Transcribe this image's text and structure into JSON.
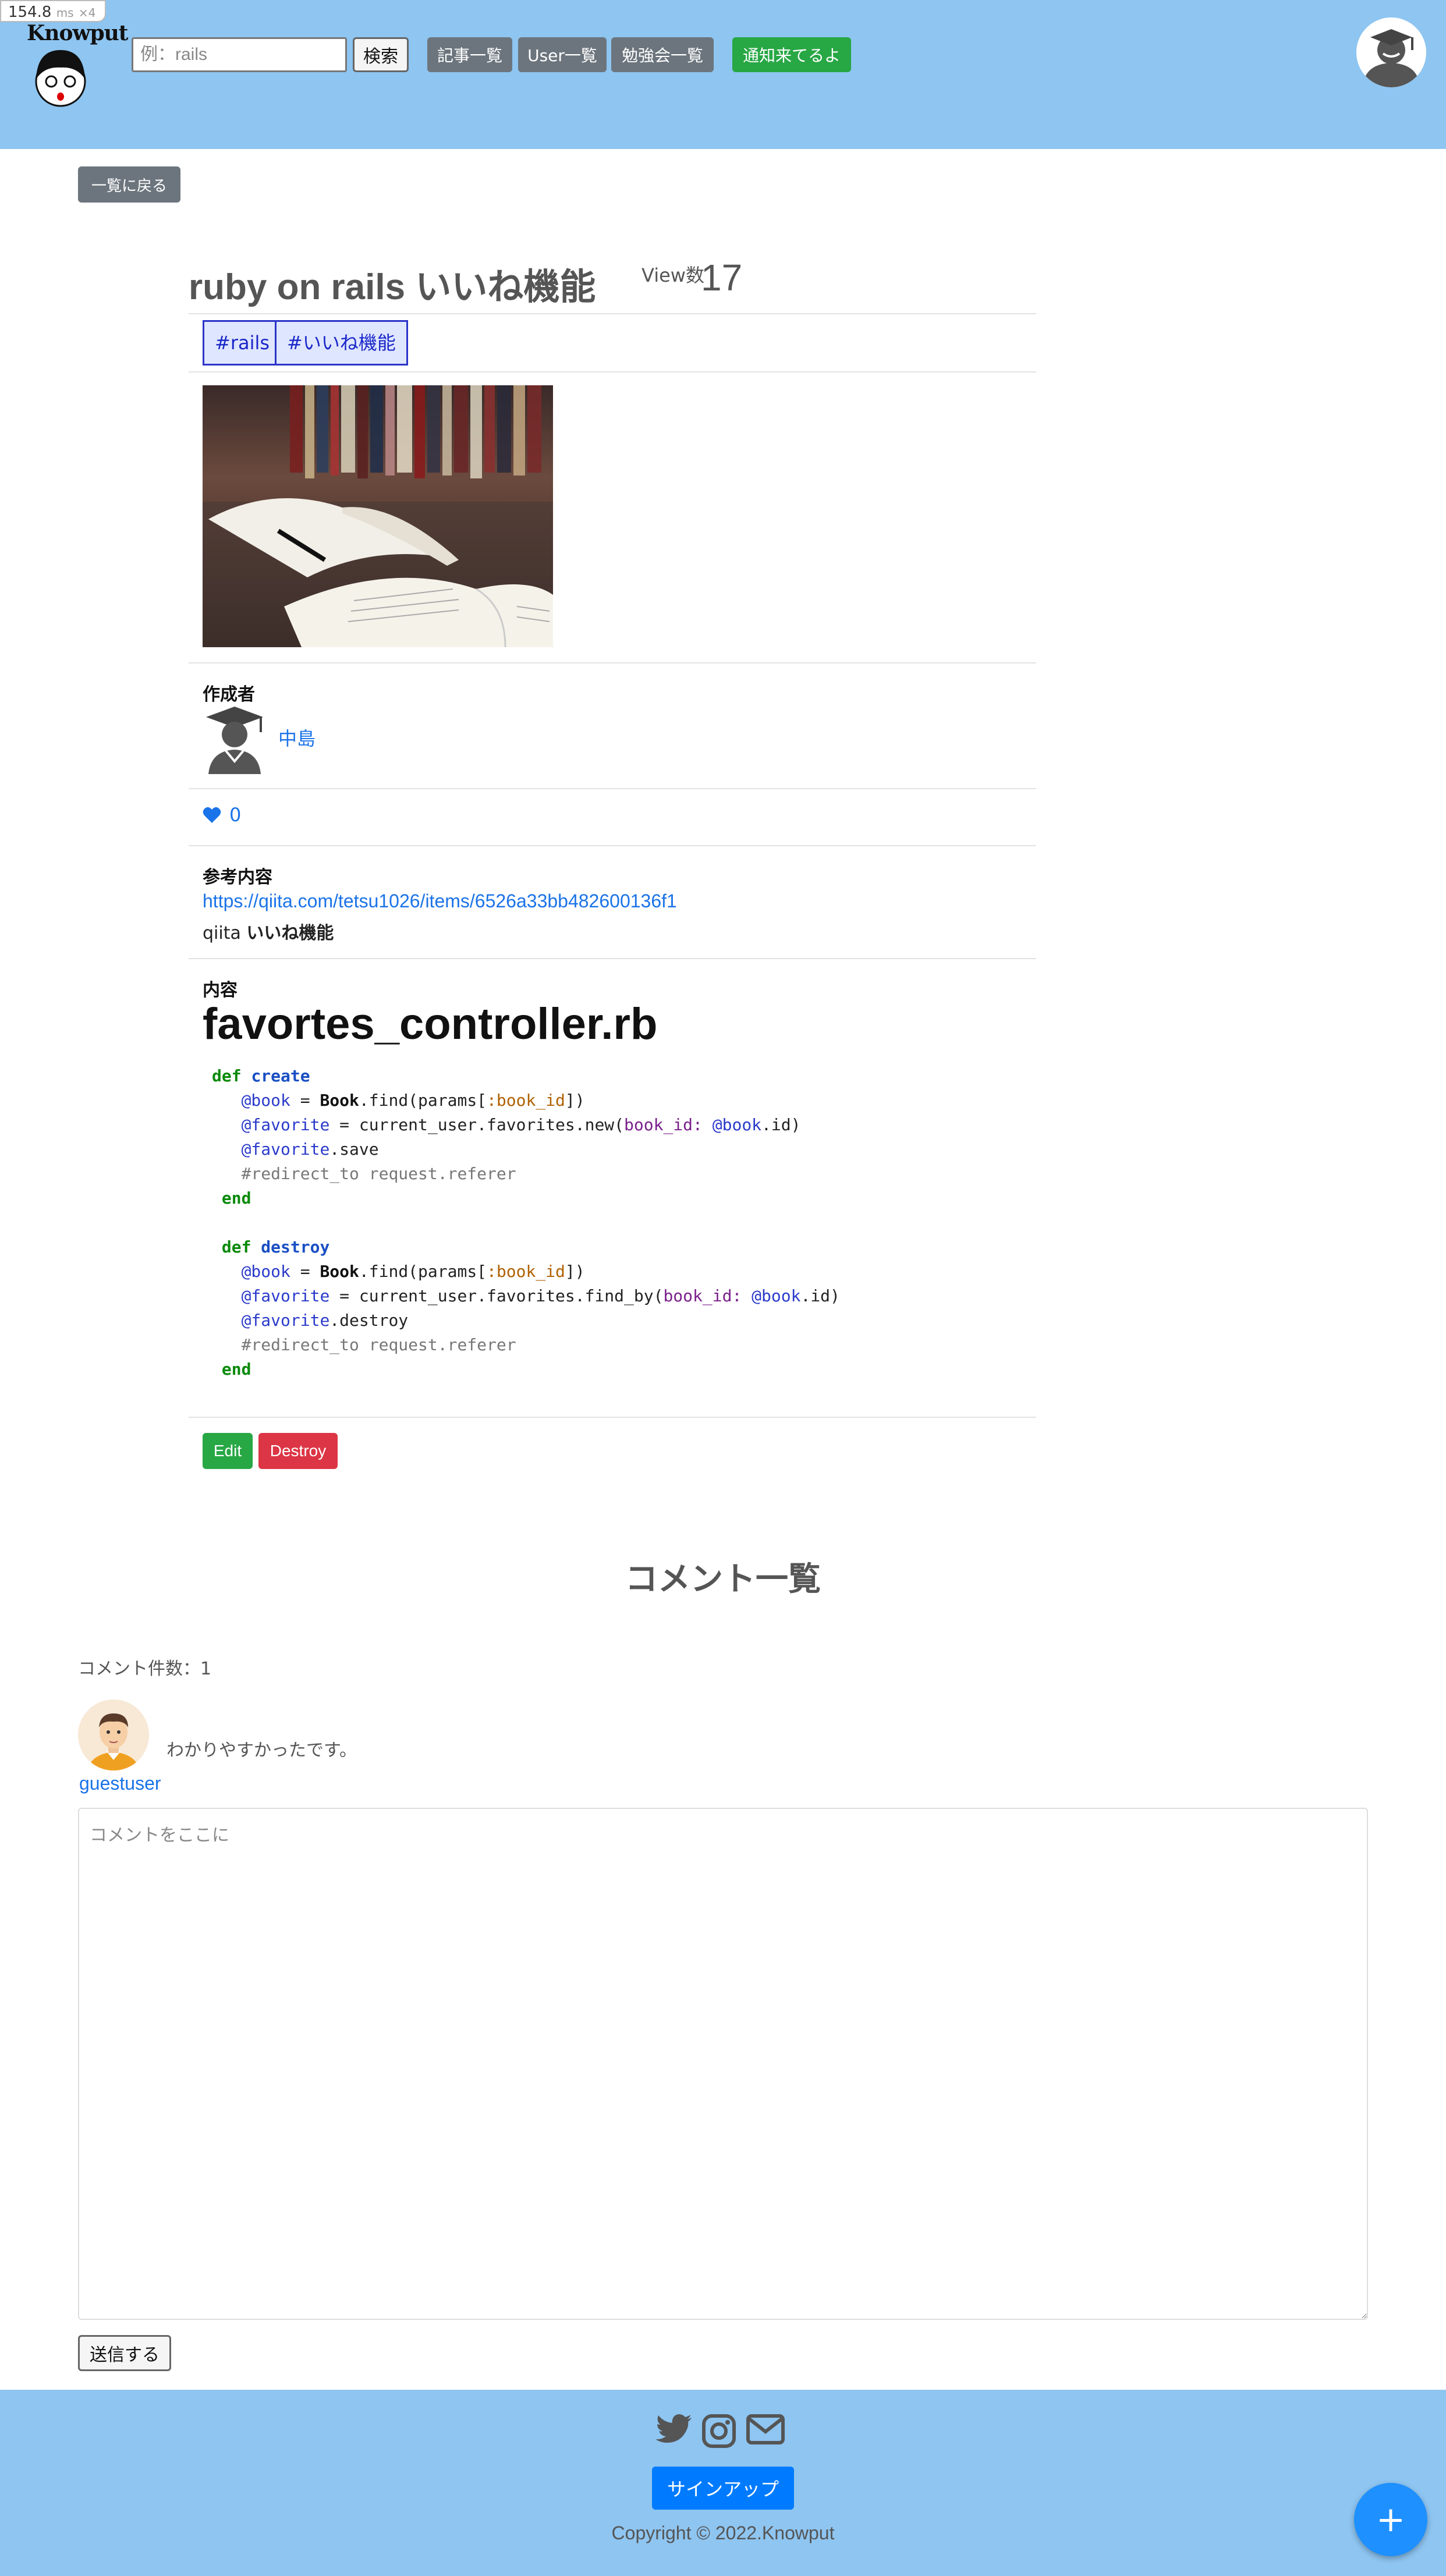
{
  "perf": {
    "value": "154.8",
    "unit": "ms",
    "multiplier": "×4"
  },
  "header": {
    "logo_text": "Knowput",
    "search": {
      "placeholder": "例：rails",
      "value": ""
    },
    "search_button": "検索",
    "nav": [
      "記事一覧",
      "User一覧",
      "勉強会一覧"
    ],
    "notify_button": "通知来てるよ",
    "colors": {
      "background": "#8ec5f1",
      "nav_button": "#6c757d",
      "notify_button": "#28a745"
    }
  },
  "back_button": "一覧に戻る",
  "article": {
    "title": "ruby on rails いいね機能",
    "view_label": "View数",
    "view_count": "17",
    "tags": [
      "#rails",
      "#いいね機能"
    ],
    "author_label": "作成者",
    "author_name": "中島",
    "likes": "0",
    "reference_label": "参考内容",
    "reference_url": "https://qiita.com/tetsu1026/items/6526a33bb482600136f1",
    "reference_desc_prefix": "qiita ",
    "reference_desc_bold": "いいね機能",
    "content_label": "内容",
    "content_heading": "favortes_controller.rb",
    "code_lines": [
      [
        [
          "kw",
          "def"
        ],
        [
          "t",
          " "
        ],
        [
          "fn",
          "create"
        ]
      ],
      [
        [
          "t",
          "   "
        ],
        [
          "iv",
          "@book"
        ],
        [
          "t",
          " = "
        ],
        [
          "cl",
          "Book"
        ],
        [
          "t",
          ".find(params["
        ],
        [
          "sy",
          ":book_id"
        ],
        [
          "t",
          "])"
        ]
      ],
      [
        [
          "t",
          "   "
        ],
        [
          "iv",
          "@favorite"
        ],
        [
          "t",
          " = current_user.favorites.new("
        ],
        [
          "km",
          "book_id:"
        ],
        [
          "t",
          " "
        ],
        [
          "iv",
          "@book"
        ],
        [
          "t",
          ".id)"
        ]
      ],
      [
        [
          "t",
          "   "
        ],
        [
          "iv",
          "@favorite"
        ],
        [
          "t",
          ".save"
        ]
      ],
      [
        [
          "t",
          "   "
        ],
        [
          "cm",
          "#redirect_to request.referer"
        ]
      ],
      [
        [
          "t",
          " "
        ],
        [
          "kw",
          "end"
        ]
      ],
      [
        [
          "t",
          ""
        ]
      ],
      [
        [
          "t",
          " "
        ],
        [
          "kw",
          "def"
        ],
        [
          "t",
          " "
        ],
        [
          "fn",
          "destroy"
        ]
      ],
      [
        [
          "t",
          "   "
        ],
        [
          "iv",
          "@book"
        ],
        [
          "t",
          " = "
        ],
        [
          "cl",
          "Book"
        ],
        [
          "t",
          ".find(params["
        ],
        [
          "sy",
          ":book_id"
        ],
        [
          "t",
          "])"
        ]
      ],
      [
        [
          "t",
          "   "
        ],
        [
          "iv",
          "@favorite"
        ],
        [
          "t",
          " = current_user.favorites.find_by("
        ],
        [
          "km",
          "book_id:"
        ],
        [
          "t",
          " "
        ],
        [
          "iv",
          "@book"
        ],
        [
          "t",
          ".id)"
        ]
      ],
      [
        [
          "t",
          "   "
        ],
        [
          "iv",
          "@favorite"
        ],
        [
          "t",
          ".destroy"
        ]
      ],
      [
        [
          "t",
          "   "
        ],
        [
          "cm",
          "#redirect_to request.referer"
        ]
      ],
      [
        [
          "t",
          " "
        ],
        [
          "kw",
          "end"
        ]
      ]
    ],
    "edit_button": "Edit",
    "destroy_button": "Destroy"
  },
  "comments": {
    "title": "コメント一覧",
    "count_label": "コメント件数：1",
    "items": [
      {
        "text": "わかりやすかったです。",
        "user": "guestuser"
      }
    ],
    "input_placeholder": "コメントをここに",
    "submit_button": "送信する"
  },
  "footer": {
    "signup_button": "サインアップ",
    "copyright": "Copyright © 2022.Knowput",
    "icons": [
      "twitter-icon",
      "instagram-icon",
      "mail-icon"
    ]
  },
  "fab_label": "+"
}
